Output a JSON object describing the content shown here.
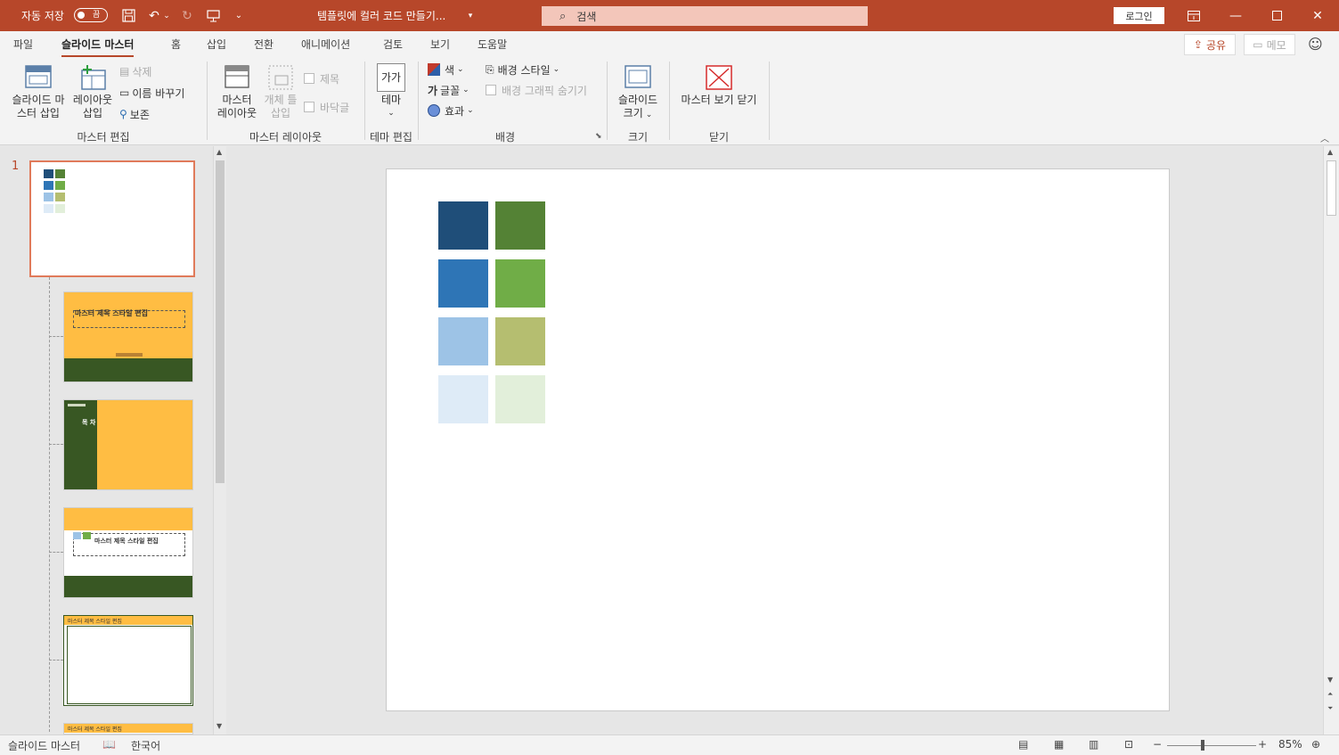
{
  "titlebar": {
    "autosave_label": "자동 저장",
    "autosave_state": "끔",
    "doc_title": "템플릿에 컬러 코드 만들기...",
    "search_placeholder": "검색",
    "login_label": "로그인"
  },
  "tabs": [
    "파일",
    "슬라이드 마스터",
    "홈",
    "삽입",
    "전환",
    "애니메이션",
    "검토",
    "보기",
    "도움말"
  ],
  "active_tab": "슬라이드 마스터",
  "share_label": "공유",
  "memo_label": "메모",
  "ribbon": {
    "insert_slide_master": [
      "슬라이드 마",
      "스터 삽입"
    ],
    "insert_layout": [
      "레이아웃",
      "삽입"
    ],
    "delete": "삭제",
    "rename": "이름 바꾸기",
    "preserve": "보존",
    "group_master_edit": "마스터 편집",
    "master_layout": [
      "마스터",
      "레이아웃"
    ],
    "insert_placeholder": [
      "개체 틀",
      "삽입"
    ],
    "title_check": "제목",
    "footer_check": "바닥글",
    "group_master_layout": "마스터 레이아웃",
    "theme": "테마",
    "theme_icon_text": "가가",
    "group_theme_edit": "테마 편집",
    "colors": "색",
    "fonts": "글꼴",
    "effects": "효과",
    "bg_styles": "배경 스타일",
    "hide_bg": "배경 그래픽 숨기기",
    "group_background": "배경",
    "slide_size": [
      "슬라이드",
      "크기"
    ],
    "group_size": "크기",
    "close_master": "마스터 보기 닫기",
    "group_close": "닫기"
  },
  "thumbnails": {
    "slide_number": "1",
    "layout1_title": "마스터 제목 스타일 편집",
    "layout2_title": "목 차",
    "layout3_title": "마스터 제목 스타일 편집",
    "layout4_title": "마스터 제목 스타일 편집",
    "layout5_title": "마스터 제목 스타일 편집"
  },
  "swatches": {
    "left": [
      "#1f4e79",
      "#2e75b6",
      "#9dc3e6",
      "#deebf7"
    ],
    "right": [
      "#548235",
      "#70ad47",
      "#b5be70",
      "#e2efda"
    ]
  },
  "statusbar": {
    "view": "슬라이드 마스터",
    "language": "한국어",
    "zoom": "85%"
  },
  "colors": {
    "accent": "#b7472a",
    "thumb_yellow": "#ffbd43",
    "thumb_green": "#385723"
  }
}
